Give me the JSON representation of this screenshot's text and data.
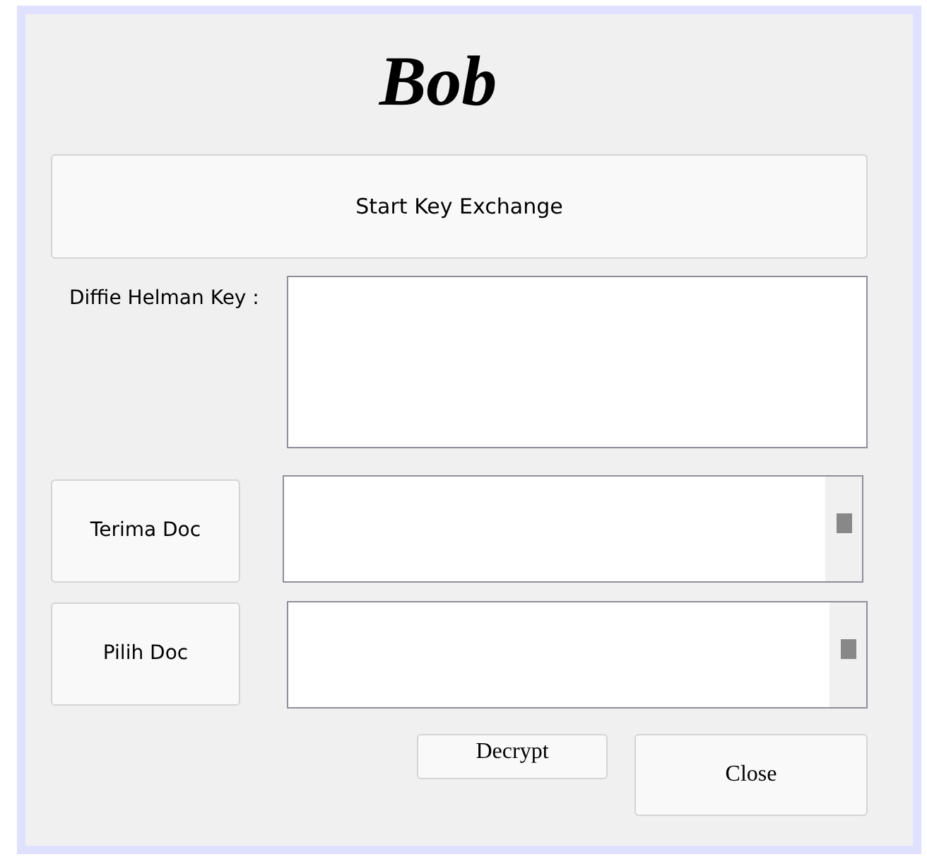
{
  "window": {
    "title": "Bob"
  },
  "start_button": {
    "label": "Start Key Exchange"
  },
  "key_field": {
    "label": "Diffie Helman Key :"
  },
  "document_rows": [
    {
      "button": "Terima Doc"
    },
    {
      "button": "Pilih Doc"
    }
  ],
  "buttons": [
    {
      "label": "Decrypt"
    },
    {
      "label": "Close"
    }
  ]
}
